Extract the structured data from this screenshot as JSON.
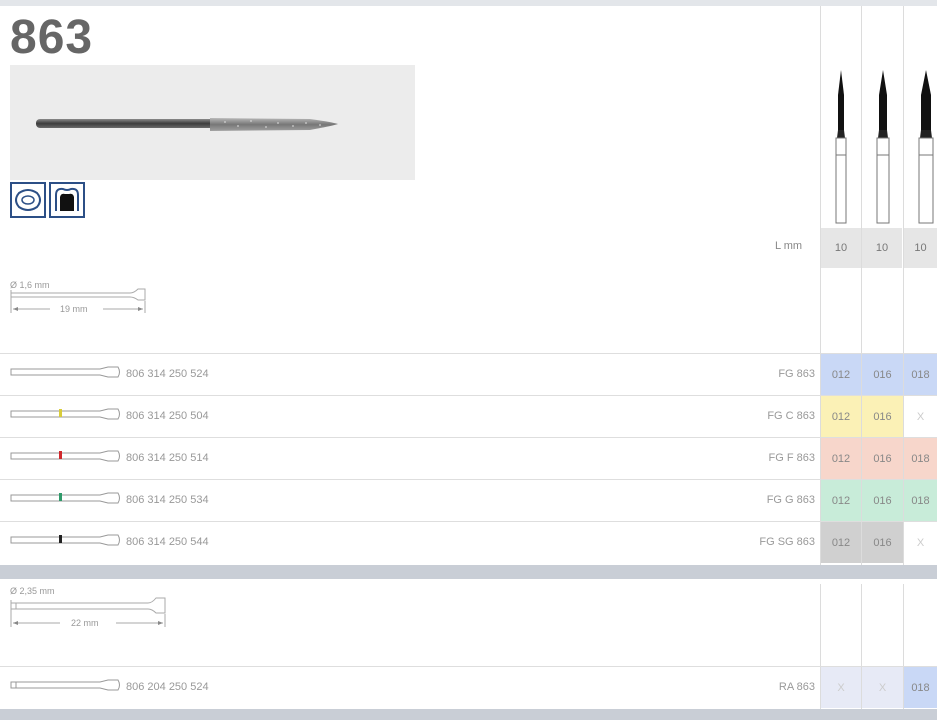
{
  "product": {
    "number": "863",
    "icons": [
      "cavity-prep-icon",
      "tooth-icon"
    ]
  },
  "header": {
    "length_label": "L mm",
    "length_values": [
      "10",
      "10",
      "10"
    ]
  },
  "shank1": {
    "diameter_label": "Ø 1,6 mm",
    "length_label": "19 mm"
  },
  "shank2": {
    "diameter_label": "Ø 2,35 mm",
    "length_label": "22 mm"
  },
  "colors": {
    "standard": "#c9d8f6",
    "coarse_band": "#d8cc3a",
    "coarse_cell": "#fbf1b6",
    "fine_band": "#d0282c",
    "fine_cell": "#f7d6cb",
    "green_band": "#2f9a6a",
    "green_cell": "#c8ecd9",
    "black_band": "#222222",
    "sg_cell": "#d0d0d0",
    "ra_cell": "#e7eaf6",
    "bar": "#c9ced6"
  },
  "rows": [
    {
      "code": "806 314 250 524",
      "ref": "FG 863",
      "sizes": [
        "012",
        "016",
        "018"
      ]
    },
    {
      "code": "806 314 250 504",
      "ref": "FG C 863",
      "sizes": [
        "012",
        "016",
        "X"
      ]
    },
    {
      "code": "806 314 250 514",
      "ref": "FG F 863",
      "sizes": [
        "012",
        "016",
        "018"
      ]
    },
    {
      "code": "806 314 250 534",
      "ref": "FG G 863",
      "sizes": [
        "012",
        "016",
        "018"
      ]
    },
    {
      "code": "806 314 250 544",
      "ref": "FG SG 863",
      "sizes": [
        "012",
        "016",
        "X"
      ]
    }
  ],
  "ra_row": {
    "code": "806 204 250 524",
    "ref": "RA 863",
    "sizes": [
      "X",
      "X",
      "018"
    ]
  }
}
